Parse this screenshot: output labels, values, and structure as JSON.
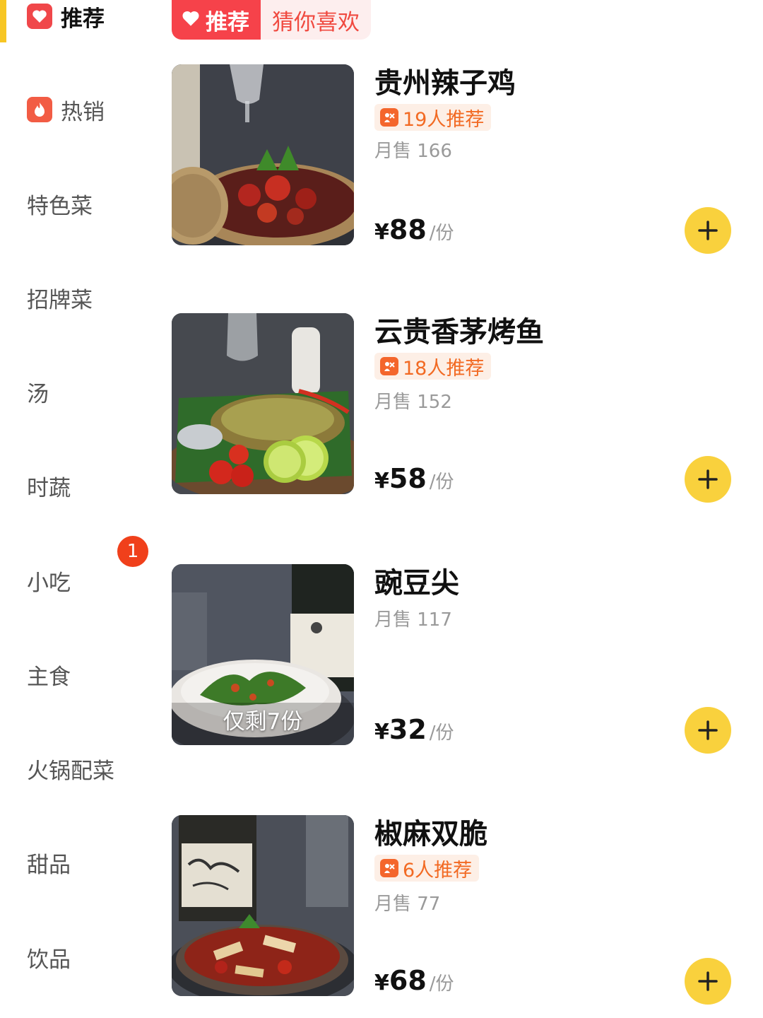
{
  "colors": {
    "accent_yellow": "#f7c624",
    "tab_red": "#f6424a",
    "badge_orange": "#f26a23",
    "add_button": "#f9d13d"
  },
  "sidebar": {
    "items": [
      {
        "label": "推荐",
        "icon": "heart-icon",
        "active": true
      },
      {
        "label": "热销",
        "icon": "fire-icon"
      },
      {
        "label": "特色菜"
      },
      {
        "label": "招牌菜"
      },
      {
        "label": "汤"
      },
      {
        "label": "时蔬"
      },
      {
        "label": "小吃",
        "badge": "1"
      },
      {
        "label": "主食"
      },
      {
        "label": "火锅配菜"
      },
      {
        "label": "甜品"
      },
      {
        "label": "饮品"
      }
    ]
  },
  "tabs": {
    "recommend": "推荐",
    "guess": "猜你喜欢"
  },
  "dishes": [
    {
      "name": "贵州辣子鸡",
      "recommend": "19人推荐",
      "monthly": "月售 166",
      "currency": "¥",
      "price": "88",
      "unit": "/份",
      "image": "spicy-chicken-photo"
    },
    {
      "name": "云贵香茅烤鱼",
      "recommend": "18人推荐",
      "monthly": "月售 152",
      "currency": "¥",
      "price": "58",
      "unit": "/份",
      "image": "lemongrass-fish-photo"
    },
    {
      "name": "豌豆尖",
      "monthly": "月售 117",
      "currency": "¥",
      "price": "32",
      "unit": "/份",
      "stock": "仅剩7份",
      "image": "pea-shoots-photo"
    },
    {
      "name": "椒麻双脆",
      "recommend": "6人推荐",
      "monthly": "月售 77",
      "currency": "¥",
      "price": "68",
      "unit": "/份",
      "image": "pepper-crisp-photo"
    }
  ]
}
